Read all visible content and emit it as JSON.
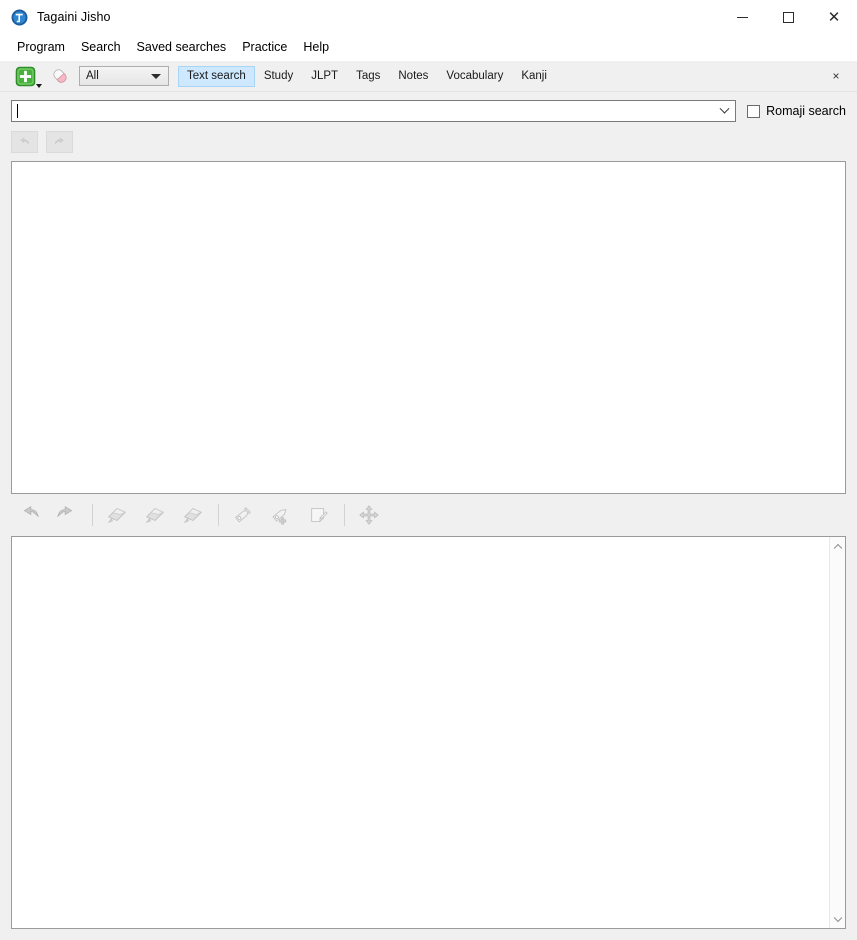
{
  "window": {
    "title": "Tagaini Jisho",
    "app_icon": "tagaini-logo-icon",
    "controls": {
      "minimize": "minimize-icon",
      "maximize": "maximize-icon",
      "close": "close-icon"
    }
  },
  "menubar": {
    "items": [
      {
        "label": "Program"
      },
      {
        "label": "Search"
      },
      {
        "label": "Saved searches"
      },
      {
        "label": "Practice"
      },
      {
        "label": "Help"
      }
    ]
  },
  "search_toolbar": {
    "add_entry_button": "add-entry-icon",
    "clear_button": "eraser-icon",
    "filter_combo": {
      "value": "All",
      "options": [
        "All"
      ]
    },
    "tabs": [
      {
        "label": "Text search",
        "selected": true
      },
      {
        "label": "Study",
        "selected": false
      },
      {
        "label": "JLPT",
        "selected": false
      },
      {
        "label": "Tags",
        "selected": false
      },
      {
        "label": "Notes",
        "selected": false
      },
      {
        "label": "Vocabulary",
        "selected": false
      },
      {
        "label": "Kanji",
        "selected": false
      }
    ],
    "close_tabbar": "×"
  },
  "search_row": {
    "input_value": "",
    "input_placeholder": "",
    "dropdown_icon": "chevron-down-icon",
    "romaji_checkbox": {
      "label": "Romaji search",
      "checked": false
    }
  },
  "history_nav": {
    "previous_button": "previous-results-icon",
    "next_button": "next-results-icon",
    "enabled": false
  },
  "draw_toolbar": {
    "buttons": [
      {
        "name": "undo-icon",
        "enabled": false
      },
      {
        "name": "redo-icon",
        "enabled": false
      },
      {
        "name": "study-add-icon",
        "enabled": false
      },
      {
        "name": "study-edit-icon",
        "enabled": false
      },
      {
        "name": "study-remove-icon",
        "enabled": false
      },
      {
        "name": "tag-edit-icon",
        "enabled": false
      },
      {
        "name": "tag-add-icon",
        "enabled": false
      },
      {
        "name": "note-edit-icon",
        "enabled": false
      },
      {
        "name": "move-icon",
        "enabled": false
      }
    ]
  },
  "results_panel": {
    "items": [],
    "empty": true
  },
  "detail_panel": {
    "content": "",
    "empty": true,
    "scrollbar": {
      "up_arrow": "chevron-up-icon",
      "down_arrow": "chevron-down-icon"
    }
  },
  "colors": {
    "window_bg": "#f0f0f0",
    "titlebar_bg": "#ffffff",
    "panel_bg": "#ffffff",
    "panel_border": "#9a9a9a",
    "tab_selected_bg": "#cde8ff",
    "accent_green": "#4caf3f",
    "accent_blue": "#1b6fb5"
  }
}
